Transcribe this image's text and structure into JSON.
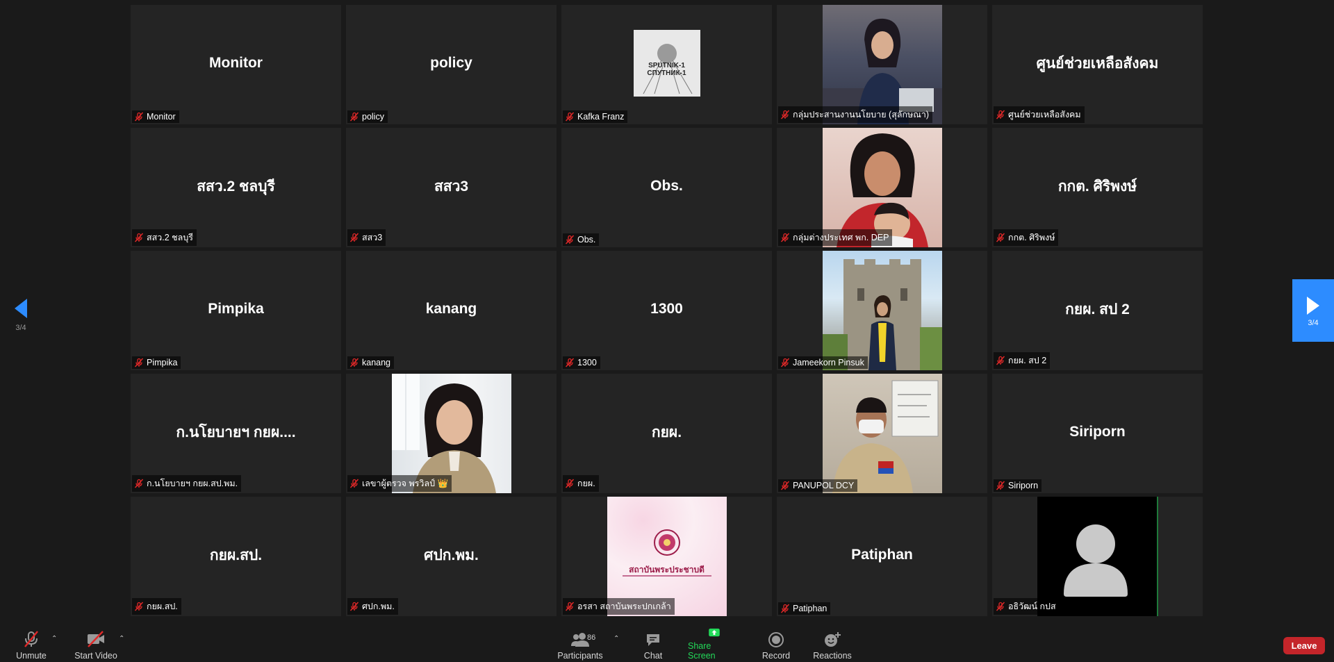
{
  "pagination": {
    "left_label": "3/4",
    "right_label": "3/4"
  },
  "tiles": [
    {
      "display": "Monitor",
      "name": "Monitor",
      "kind": "text"
    },
    {
      "display": "policy",
      "name": "policy",
      "kind": "text"
    },
    {
      "display": "",
      "name": "Kafka Franz",
      "kind": "thumb-sputnik",
      "thumb_text": "SPUTNIK-1 СПУТНИК-1"
    },
    {
      "display": "",
      "name": "กลุ่มประสานงานนโยบาย (สุลักษณา)",
      "kind": "photo-woman-desk"
    },
    {
      "display": "ศูนย์ช่วยเหลือสังคม",
      "name": "ศูนย์ช่วยเหลือสังคม",
      "kind": "text"
    },
    {
      "display": "สสว.2 ชลบุรี",
      "name": "สสว.2 ชลบุรี",
      "kind": "text"
    },
    {
      "display": "สสว3",
      "name": "สสว3",
      "kind": "text"
    },
    {
      "display": "Obs.",
      "name": "Obs.",
      "kind": "text"
    },
    {
      "display": "",
      "name": "กลุ่มต่างประเทศ พก. DEP",
      "kind": "photo-mother"
    },
    {
      "display": "กกต. ศิริพงษ์",
      "name": "กกต. ศิริพงษ์",
      "kind": "text"
    },
    {
      "display": "Pimpika",
      "name": "Pimpika",
      "kind": "text"
    },
    {
      "display": "kanang",
      "name": "kanang",
      "kind": "text"
    },
    {
      "display": "1300",
      "name": "1300",
      "kind": "text"
    },
    {
      "display": "",
      "name": "Jameekorn Pinsuk",
      "kind": "photo-castle"
    },
    {
      "display": "กยผ. สป 2",
      "name": "กยผ. สป 2",
      "kind": "text"
    },
    {
      "display": "ก.นโยบายฯ กยผ....",
      "name": "ก.นโยบายฯ กยผ.สป.พม.",
      "kind": "text"
    },
    {
      "display": "",
      "name": "เลขาผู้ตรวจ พรวิลป์ 👑",
      "kind": "photo-officer-woman"
    },
    {
      "display": "กยผ.",
      "name": "กยผ.",
      "kind": "text"
    },
    {
      "display": "",
      "name": "PANUPOL DCY",
      "kind": "photo-officer-man"
    },
    {
      "display": "Siriporn",
      "name": "Siriporn",
      "kind": "text"
    },
    {
      "display": "กยผ.สป.",
      "name": "กยผ.สป.",
      "kind": "text"
    },
    {
      "display": "ศปก.พม.",
      "name": "ศปก.พม.",
      "kind": "text"
    },
    {
      "display": "",
      "name": "อรสา สถาบันพระปกเกล้า",
      "kind": "photo-logo",
      "logo_text": "สถาบันพระประชาบดี"
    },
    {
      "display": "Patiphan",
      "name": "Patiphan",
      "kind": "text"
    },
    {
      "display": "",
      "name": "อธิวัฒน์ กปส",
      "kind": "avatar"
    }
  ],
  "toolbar": {
    "unmute": "Unmute",
    "start_video": "Start Video",
    "participants": "Participants",
    "participants_count": "86",
    "chat": "Chat",
    "share_screen": "Share Screen",
    "record": "Record",
    "reactions": "Reactions",
    "leave": "Leave"
  },
  "colors": {
    "background": "#1a1a1a",
    "tile": "#242424",
    "accent": "#2d8cff",
    "share_green": "#23d959",
    "leave_red": "#c4252a",
    "mic_off_red": "#e02828"
  }
}
